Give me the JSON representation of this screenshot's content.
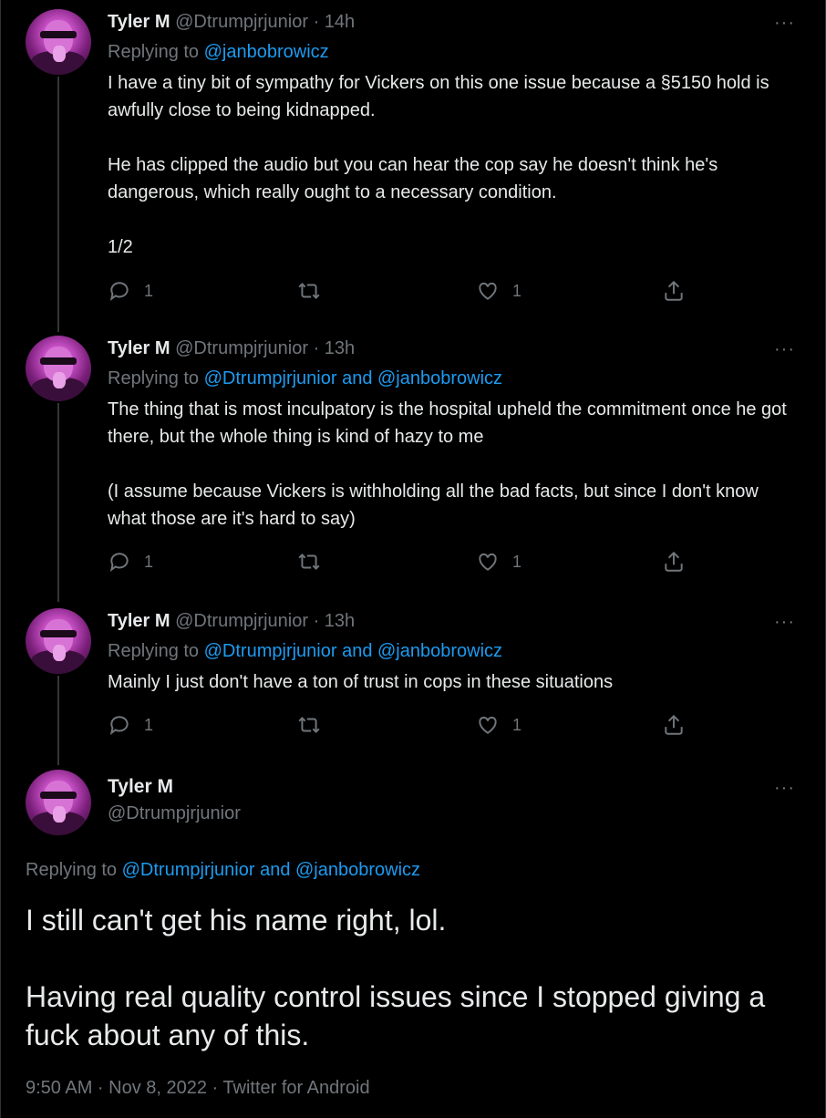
{
  "tweets": [
    {
      "name": "Tyler M",
      "handle": "@Dtrumpjrjunior",
      "time": "14h",
      "replying_prefix": "Replying to",
      "replying_to": "@janbobrowicz",
      "paragraphs": [
        "I have a tiny bit of sympathy for Vickers on this one issue because a §5150 hold is awfully close to being kidnapped.",
        "He has clipped the audio but you can hear the cop say he doesn't think he's dangerous, which really ought to a necessary condition.",
        "1/2"
      ],
      "reply_count": "1",
      "like_count": "1"
    },
    {
      "name": "Tyler M",
      "handle": "@Dtrumpjrjunior",
      "time": "13h",
      "replying_prefix": "Replying to",
      "replying_to": "@Dtrumpjrjunior and @janbobrowicz",
      "paragraphs": [
        "The thing that is most inculpatory is the hospital upheld the commitment once he got there, but the whole thing is kind of hazy to me",
        "(I assume because Vickers is withholding all the bad facts, but since I don't know what those are it's hard to say)"
      ],
      "reply_count": "1",
      "like_count": "1"
    },
    {
      "name": "Tyler M",
      "handle": "@Dtrumpjrjunior",
      "time": "13h",
      "replying_prefix": "Replying to",
      "replying_to": "@Dtrumpjrjunior and @janbobrowicz",
      "paragraphs": [
        "Mainly I just don't have a ton of trust in cops in these situations"
      ],
      "reply_count": "1",
      "like_count": "1"
    }
  ],
  "main_tweet": {
    "name": "Tyler M",
    "handle": "@Dtrumpjrjunior",
    "replying_prefix": "Replying to",
    "replying_to": "@Dtrumpjrjunior and @janbobrowicz",
    "paragraphs": [
      "I still can't get his name right, lol.",
      "Having real quality control issues since I stopped giving a fuck about any of this."
    ],
    "footer": "9:50 AM · Nov 8, 2022 · Twitter for Android"
  },
  "more_icon": "···",
  "separator": "·",
  "colors": {
    "background": "#000000",
    "text": "#e7e9ea",
    "muted": "#71767b",
    "link": "#1d9bf0",
    "thread_line": "#333639"
  },
  "icons": [
    "reply-icon",
    "retweet-icon",
    "like-icon",
    "share-icon",
    "more-icon"
  ]
}
